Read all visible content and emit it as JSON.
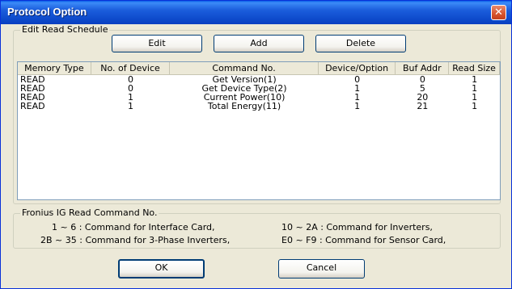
{
  "window": {
    "title": "Protocol Option"
  },
  "schedule": {
    "group_label": "Edit Read Schedule",
    "edit_label": "Edit",
    "add_label": "Add",
    "delete_label": "Delete",
    "columns": [
      "Memory Type",
      "No. of Device",
      "Command No.",
      "Device/Option",
      "Buf Addr",
      "Read Size"
    ],
    "rows": [
      [
        "READ",
        "0",
        "Get Version(1)",
        "0",
        "0",
        "1"
      ],
      [
        "READ",
        "0",
        "Get Device Type(2)",
        "1",
        "5",
        "1"
      ],
      [
        "READ",
        "1",
        "Current Power(10)",
        "1",
        "20",
        "1"
      ],
      [
        "READ",
        "1",
        "Total Energy(11)",
        "1",
        "21",
        "1"
      ]
    ]
  },
  "info": {
    "group_label": "Fronius IG Read Command No.",
    "line1_left": "1 ~ 6 : Command for Interface Card,",
    "line1_right": "10 ~ 2A : Command for Inverters,",
    "line2_left": "2B ~ 35 : Command for 3-Phase Inverters,",
    "line2_right": "E0 ~ F9 : Command for Sensor Card,"
  },
  "footer": {
    "ok_label": "OK",
    "cancel_label": "Cancel"
  }
}
